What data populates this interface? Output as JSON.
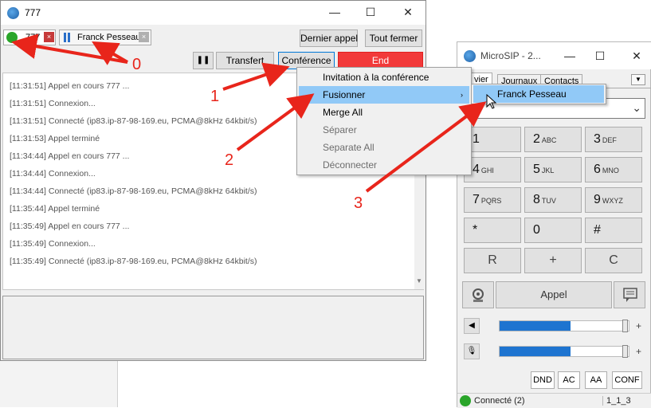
{
  "call_window": {
    "title": "777",
    "tabs": [
      {
        "label": "777",
        "close": "×"
      },
      {
        "label": "Franck Pesseau",
        "close": "×"
      }
    ],
    "buttons": {
      "last_call": "Dernier appel",
      "close_all": "Tout fermer",
      "pause": "❚❚",
      "transfer": "Transfert",
      "conference": "Conférence",
      "end": "End"
    },
    "log": [
      {
        "time": "[11:31:51]",
        "text": "Appel en cours 777 ..."
      },
      {
        "time": "[11:31:51]",
        "text": "Connexion..."
      },
      {
        "time": "[11:31:51]",
        "text": "Connecté (ip83.ip-87-98-169.eu, PCMA@8kHz 64kbit/s)"
      },
      {
        "time": "[11:31:53]",
        "text": "Appel terminé"
      },
      {
        "time": "[11:34:44]",
        "text": "Appel en cours 777 ..."
      },
      {
        "time": "[11:34:44]",
        "text": "Connexion..."
      },
      {
        "time": "[11:34:44]",
        "text": "Connecté (ip83.ip-87-98-169.eu, PCMA@8kHz 64kbit/s)"
      },
      {
        "time": "[11:35:44]",
        "text": "Appel terminé"
      },
      {
        "time": "[11:35:49]",
        "text": "Appel en cours 777 ..."
      },
      {
        "time": "[11:35:49]",
        "text": "Connexion..."
      },
      {
        "time": "[11:35:49]",
        "text": "Connecté (ip83.ip-87-98-169.eu, PCMA@8kHz 64kbit/s)"
      }
    ]
  },
  "conference_menu": {
    "items": [
      {
        "label": "Invitation à la conférence",
        "enabled": true
      },
      {
        "label": "Fusionner",
        "enabled": true,
        "submenu": true,
        "highlighted": true
      },
      {
        "label": "Merge All",
        "enabled": true
      },
      {
        "label": "Séparer",
        "enabled": false
      },
      {
        "label": "Separate All",
        "enabled": false
      },
      {
        "label": "Déconnecter",
        "enabled": false
      }
    ],
    "submenu_arrow": "›"
  },
  "merge_submenu": {
    "items": [
      {
        "label": "Franck Pesseau",
        "highlighted": true
      }
    ]
  },
  "microsip": {
    "title": "MicroSIP - 2...",
    "tabs": [
      "vier",
      "Journaux",
      "Contacts"
    ],
    "tab_menu": "▼",
    "keys": [
      {
        "main": "1",
        "sub": ""
      },
      {
        "main": "2",
        "sub": "ABC"
      },
      {
        "main": "3",
        "sub": "DEF"
      },
      {
        "main": "4",
        "sub": "GHI"
      },
      {
        "main": "5",
        "sub": "JKL"
      },
      {
        "main": "6",
        "sub": "MNO"
      },
      {
        "main": "7",
        "sub": "PQRS"
      },
      {
        "main": "8",
        "sub": "TUV"
      },
      {
        "main": "9",
        "sub": "WXYZ"
      },
      {
        "main": "*",
        "sub": ""
      },
      {
        "main": "0",
        "sub": ""
      },
      {
        "main": "#",
        "sub": ""
      }
    ],
    "func_keys": [
      "R",
      "+",
      "C"
    ],
    "call_label": "Appel",
    "speaker_level": 0.55,
    "mic_level": 0.55,
    "small_buttons": [
      "DND",
      "AC",
      "AA",
      "CONF"
    ],
    "status": "Connecté (2)",
    "version": "1_1_3"
  },
  "annotations": [
    "0",
    "1",
    "2",
    "3"
  ],
  "colors": {
    "end_button": "#f23a3a",
    "arrow": "#e8251b",
    "menu_highlight": "#91c9f7",
    "slider_fill": "#1e74d0"
  }
}
